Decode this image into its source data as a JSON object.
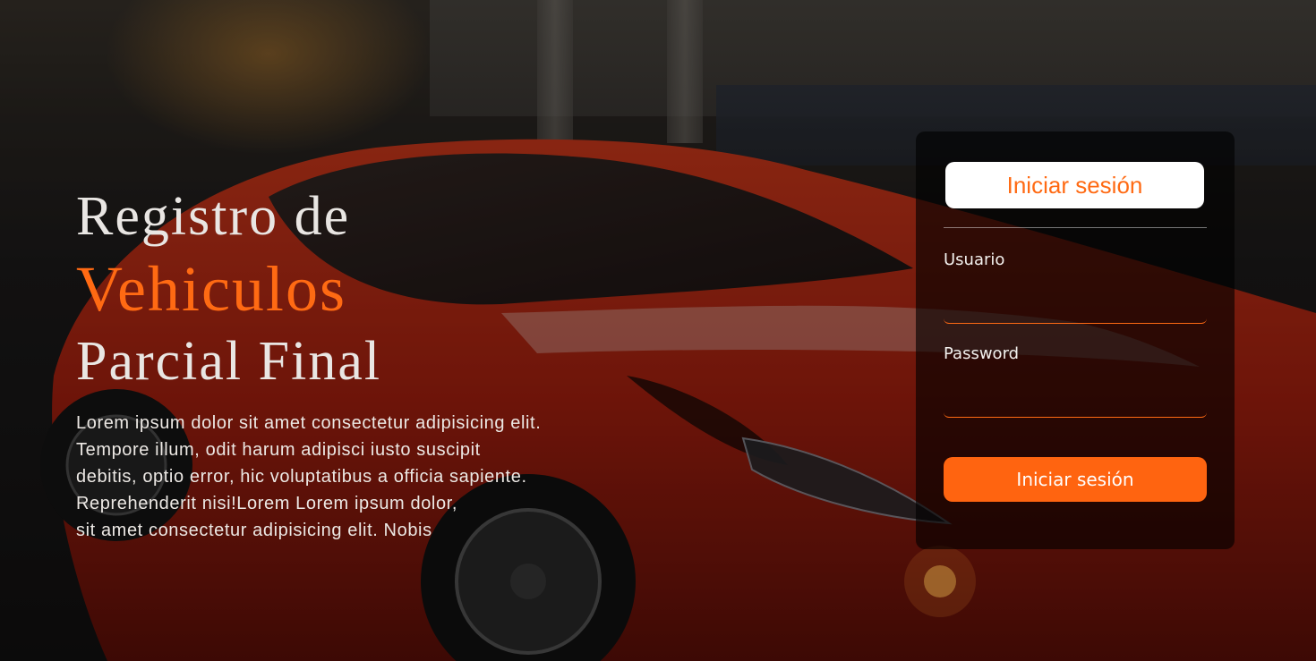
{
  "hero": {
    "title_line1": "Registro de",
    "title_line2": "Vehiculos",
    "title_line3": "Parcial Final",
    "description_lines": [
      "Lorem ipsum dolor sit amet consectetur adipisicing elit.",
      "Tempore illum, odit harum adipisci iusto suscipit",
      "debitis, optio error, hic voluptatibus a officia sapiente.",
      "Reprehenderit nisi!Lorem Lorem ipsum dolor,",
      "sit amet consectetur adipisicing elit. Nobis"
    ]
  },
  "login": {
    "title": "Iniciar sesión",
    "username_label": "Usuario",
    "username_value": "",
    "password_label": "Password",
    "password_value": "",
    "submit_label": "Iniciar sesión"
  },
  "colors": {
    "accent": "#ff6a13",
    "card_background": "rgba(0,0,0,0.62)",
    "text": "#ece8e4"
  },
  "background": {
    "image": "red-sports-car-photo"
  }
}
